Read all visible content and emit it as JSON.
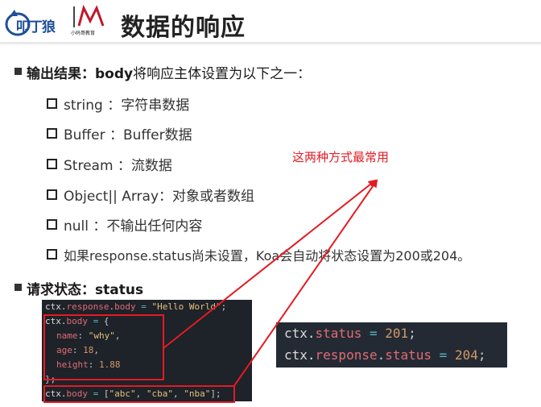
{
  "header": {
    "logo_text": "叩丁狼",
    "brand_text": "小码哥教育",
    "title": "数据的响应"
  },
  "section1": {
    "label": "输出结果：",
    "keyword": "body",
    "text": "将响应主体设置为以下之一："
  },
  "items": [
    {
      "label": "string  ：字符串数据"
    },
    {
      "label": "Buffer  ：Buffer数据"
    },
    {
      "label": "Stream  ：流数据"
    },
    {
      "label": "Object|| Array：对象或者数组"
    },
    {
      "label": "null  ：不输出任何内容"
    },
    {
      "label": "如果response.status尚未设置，Koa会自动将状态设置为200或204。"
    }
  ],
  "section2": {
    "label": "请求状态：",
    "keyword": "status"
  },
  "annotation": "这两种方式最常用",
  "code1": {
    "line1": {
      "a": "ctx.",
      "b": "response",
      "c": ".",
      "d": "body",
      "e": " = ",
      "f": "\"Hello World\"",
      "g": ";"
    },
    "line2": {
      "a": "ctx.",
      "b": "body",
      "c": " = ",
      "d": "{"
    },
    "line3": {
      "a": "name",
      "b": ": ",
      "c": "\"why\"",
      "d": ","
    },
    "line4": {
      "a": "age",
      "b": ": ",
      "c": "18",
      "d": ","
    },
    "line5": {
      "a": "height",
      "b": ": ",
      "c": "1.88"
    },
    "line6": {
      "a": "};"
    },
    "line7": {
      "a": "ctx.",
      "b": "body",
      "c": " = ",
      "d": "[",
      "e": "\"abc\"",
      "f": ", ",
      "g": "\"cba\"",
      "h": ", ",
      "i": "\"nba\"",
      "j": "];"
    }
  },
  "code2": {
    "line1": {
      "a": "ctx.",
      "b": "status",
      "c": " = ",
      "d": "201",
      "e": ";"
    },
    "line2": {
      "a": "ctx.",
      "b": "response",
      "c": ".",
      "d": "status",
      "e": " = ",
      "f": "204",
      "g": ";"
    }
  },
  "colors": {
    "accent_red": "#e31b23",
    "code_bg": "#1e2229"
  }
}
